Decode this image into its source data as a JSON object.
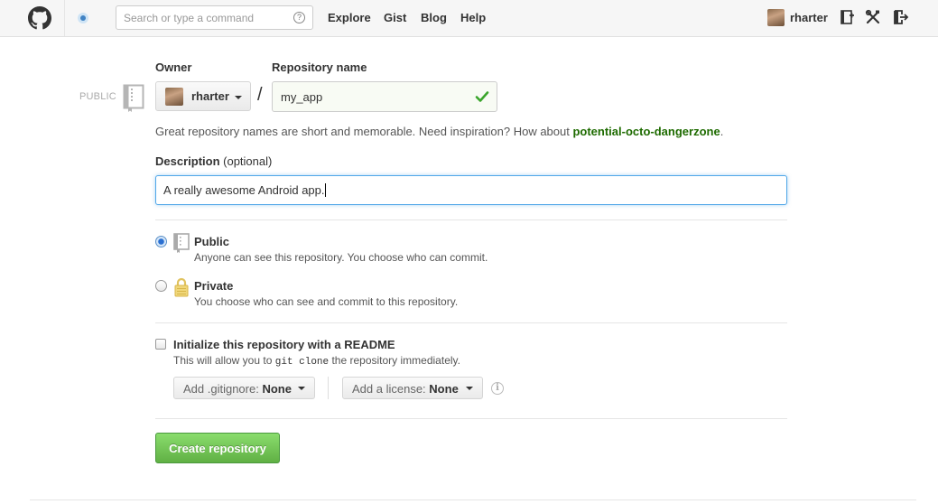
{
  "header": {
    "search_placeholder": "Search or type a command",
    "search_help": "?",
    "nav": [
      "Explore",
      "Gist",
      "Blog",
      "Help"
    ],
    "username": "rharter"
  },
  "form": {
    "visibility_tag": "PUBLIC",
    "owner_label": "Owner",
    "owner_value": "rharter",
    "slash": "/",
    "repo_name_label": "Repository name",
    "repo_name_value": "my_app",
    "hint_prefix": "Great repository names are short and memorable. Need inspiration? How about ",
    "hint_suggestion": "potential-octo-dangerzone",
    "hint_suffix": ".",
    "description_label": "Description",
    "description_optional": "(optional)",
    "description_value": "A really awesome Android app.",
    "public": {
      "title": "Public",
      "desc": "Anyone can see this repository. You choose who can commit.",
      "checked": true
    },
    "private": {
      "title": "Private",
      "desc": "You choose who can see and commit to this repository.",
      "checked": false
    },
    "readme": {
      "title": "Initialize this repository with a README",
      "desc_prefix": "This will allow you to ",
      "desc_code": "git clone",
      "desc_suffix": " the repository immediately.",
      "checked": false
    },
    "gitignore": {
      "label": "Add .gitignore:",
      "value": "None"
    },
    "license": {
      "label": "Add a license:",
      "value": "None"
    },
    "info": "i",
    "create_button": "Create repository"
  },
  "colors": {
    "accent_blue": "#4183c4",
    "create_green": "#60b044",
    "suggestion_green": "#1e6b00",
    "focus_blue": "#51a7e8"
  }
}
